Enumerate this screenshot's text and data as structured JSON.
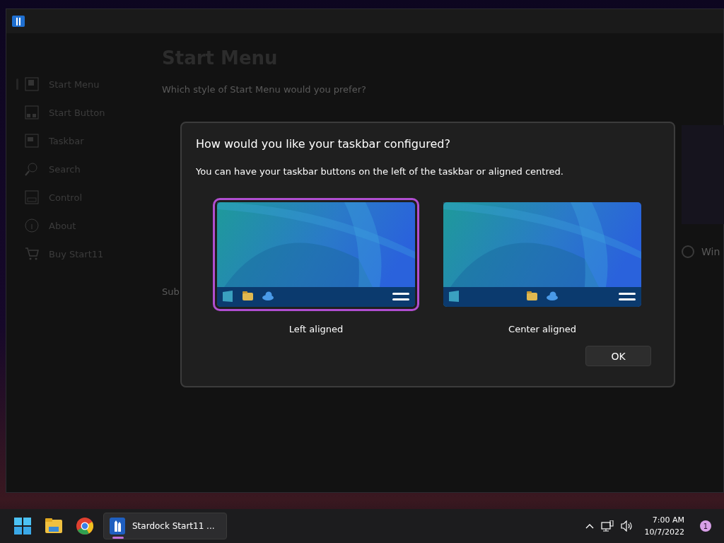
{
  "app": {
    "sidebar": [
      {
        "label": "Start Menu",
        "selected": true
      },
      {
        "label": "Start Button",
        "selected": false
      },
      {
        "label": "Taskbar",
        "selected": false
      },
      {
        "label": "Search",
        "selected": false
      },
      {
        "label": "Control",
        "selected": false
      },
      {
        "label": "About",
        "selected": false
      },
      {
        "label": "Buy Start11",
        "selected": false
      }
    ],
    "page_title": "Start Menu",
    "question": "Which style of Start Menu would you prefer?",
    "section_label": "Sub",
    "option_label": "Win",
    "option_selected": false
  },
  "dialog": {
    "title": "How would you like your taskbar configured?",
    "message": "You can have your taskbar buttons on the left of the taskbar or aligned centred.",
    "options": [
      {
        "label": "Left aligned",
        "kind": "left",
        "selected": true
      },
      {
        "label": "Center aligned",
        "kind": "center",
        "selected": false
      }
    ],
    "buttons": [
      "OK"
    ]
  },
  "taskbar": {
    "apps": [
      {
        "kind": "start"
      },
      {
        "kind": "explorer"
      },
      {
        "kind": "chrome"
      },
      {
        "kind": "window",
        "label": "Stardock Start11 ...",
        "active": true
      }
    ],
    "time": "7:00 AM",
    "date": "10/7/2022",
    "notification_count": "1"
  }
}
